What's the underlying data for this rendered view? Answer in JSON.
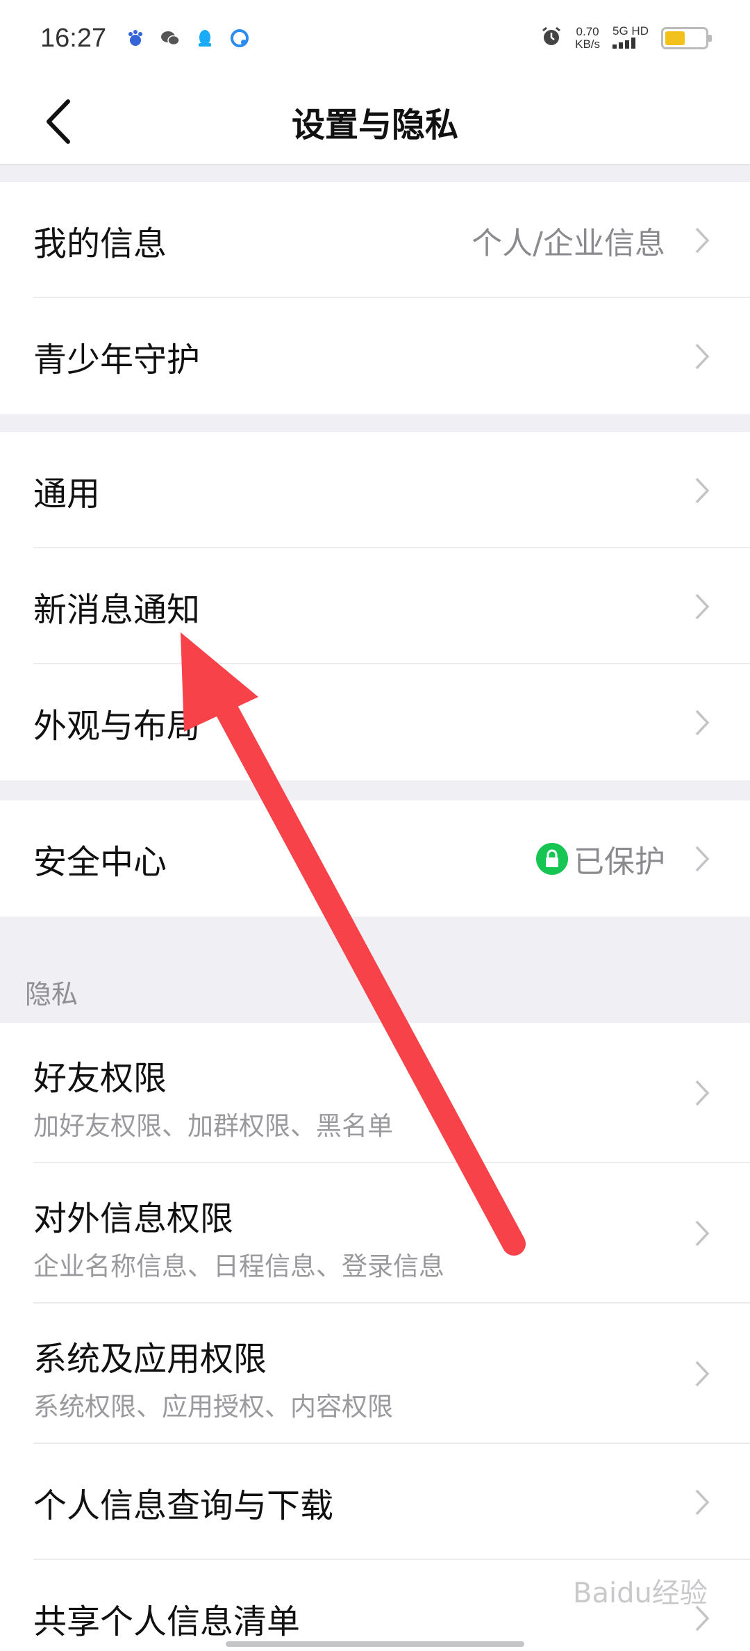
{
  "status_bar": {
    "time": "16:27",
    "net_speed_value": "0.70",
    "net_speed_unit": "KB/s",
    "network_label": "5G HD",
    "icons": [
      "baidu-icon",
      "wechat-icon",
      "qq-icon",
      "browser-icon",
      "alarm-icon",
      "signal-icon",
      "battery-icon"
    ],
    "battery_color": "#f3c11c"
  },
  "header": {
    "title": "设置与隐私"
  },
  "groups": [
    {
      "items": [
        {
          "label": "我的信息",
          "value": "个人/企业信息"
        },
        {
          "label": "青少年守护"
        }
      ]
    },
    {
      "items": [
        {
          "label": "通用"
        },
        {
          "label": "新消息通知"
        },
        {
          "label": "外观与布局"
        }
      ]
    },
    {
      "items": [
        {
          "label": "安全中心",
          "value": "已保护",
          "badge_color": "#17c553"
        }
      ]
    }
  ],
  "privacy": {
    "section_label": "隐私",
    "items": [
      {
        "label": "好友权限",
        "sub": "加好友权限、加群权限、黑名单"
      },
      {
        "label": "对外信息权限",
        "sub": "企业名称信息、日程信息、登录信息"
      },
      {
        "label": "系统及应用权限",
        "sub": "系统权限、应用授权、内容权限"
      },
      {
        "label": "个人信息查询与下载"
      },
      {
        "label": "共享个人信息清单"
      }
    ]
  },
  "annotation": {
    "arrow_color": "#f8424a"
  },
  "watermark": "Baidu经验"
}
